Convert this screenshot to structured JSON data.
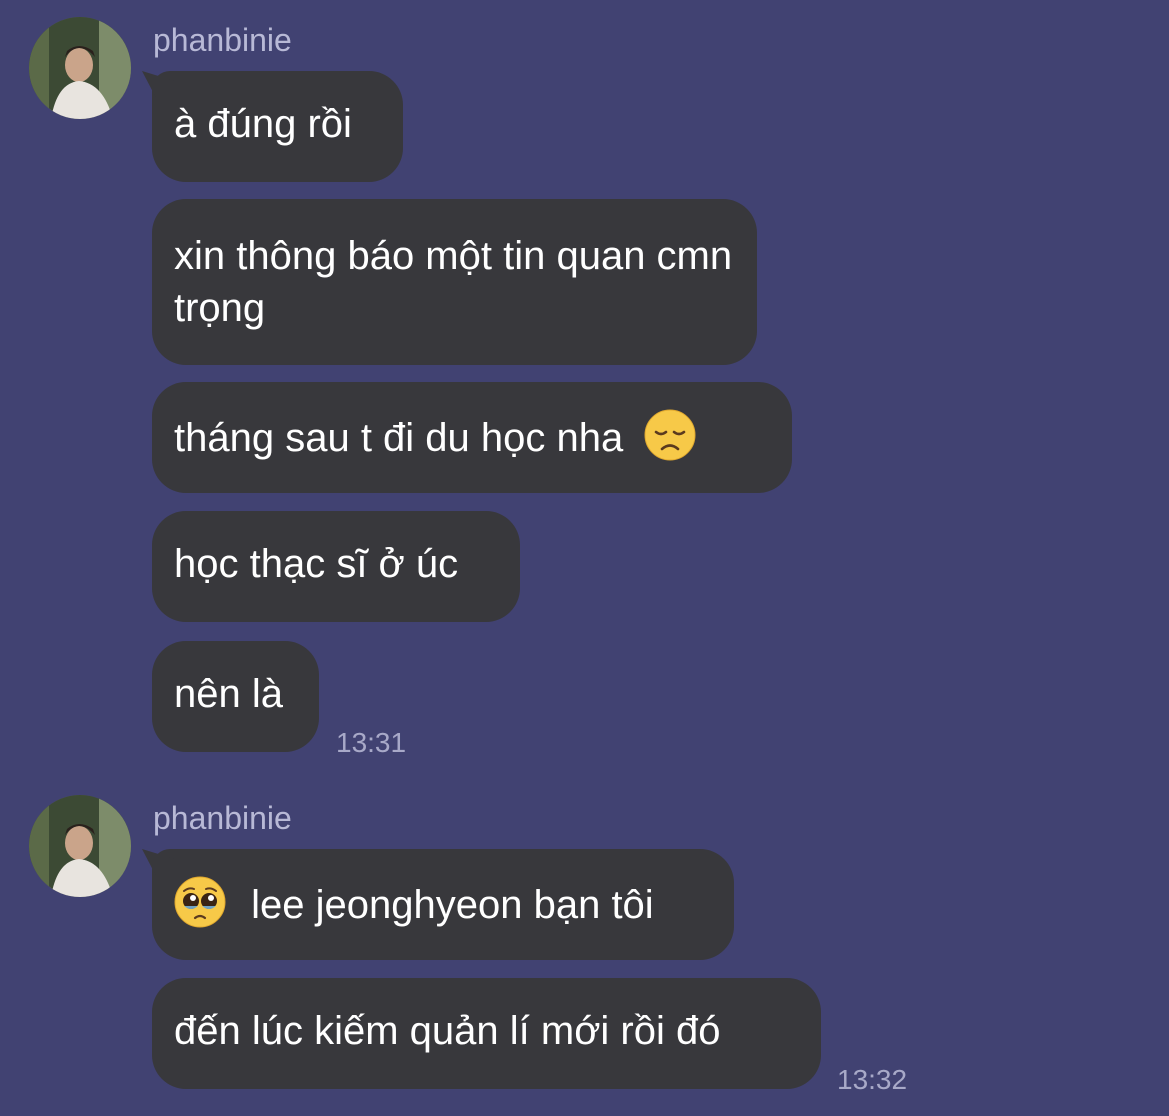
{
  "groups": [
    {
      "sender": "phanbinie",
      "messages": [
        "à đúng rồi",
        "xin thông báo một tin quan cmn trọng",
        "tháng sau t đi du học nha",
        "học thạc sĩ ở úc",
        "nên là"
      ],
      "emoji_after_message_3": "disappointed-face",
      "time": "13:31"
    },
    {
      "sender": "phanbinie",
      "messages": [
        "lee jeonghyeon bạn tôi",
        "đến lúc kiếm quản lí mới rồi đó"
      ],
      "emoji_before_message_1": "pleading-face",
      "time": "13:32"
    }
  ],
  "colors": {
    "background": "#414272",
    "bubble": "#38383c",
    "text": "#ffffff",
    "meta": "#b8b9d6"
  }
}
